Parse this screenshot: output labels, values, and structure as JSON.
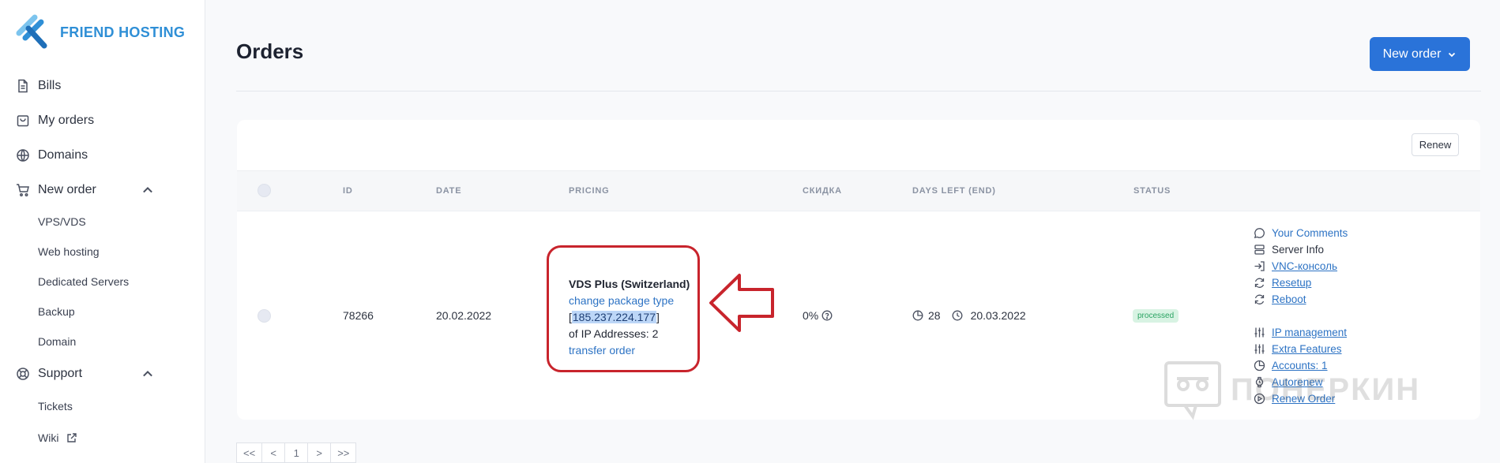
{
  "brand": {
    "name": "FRIEND HOSTING",
    "colors": {
      "accent": "#2a73d9",
      "annotation": "#c8242c",
      "status_ok": "#2aa362"
    }
  },
  "sidebar": {
    "items": [
      {
        "label": "Bills",
        "icon": "document-icon"
      },
      {
        "label": "My orders",
        "icon": "bag-icon"
      },
      {
        "label": "Domains",
        "icon": "globe-icon"
      },
      {
        "label": "New order",
        "icon": "cart-icon",
        "expanded": true,
        "children": [
          "VPS/VDS",
          "Web hosting",
          "Dedicated Servers",
          "Backup",
          "Domain"
        ]
      },
      {
        "label": "Support",
        "icon": "lifebuoy-icon",
        "expanded": true,
        "children": [
          "Tickets",
          "Wiki"
        ]
      }
    ]
  },
  "header": {
    "title": "Orders",
    "new_order_label": "New order"
  },
  "table": {
    "renew_label": "Renew",
    "columns": [
      "ID",
      "DATE",
      "PRICING",
      "СКИДКА",
      "DAYS LEFT (END)",
      "STATUS"
    ],
    "rows": [
      {
        "id": "78266",
        "date": "20.02.2022",
        "pricing": {
          "package": "VDS Plus (Switzerland)",
          "change_link": "change package type",
          "ip_open": "[",
          "ip": "185.237.224.177",
          "ip_close": "]",
          "ip_count": "of IP Addresses: 2",
          "transfer_link": "transfer order"
        },
        "discount": "0%",
        "days_left": "28",
        "end_date": "20.03.2022",
        "status": "processed",
        "actions": [
          "Your Comments",
          "Server Info",
          "VNC-консоль",
          "Resetup",
          "Reboot",
          "IP management",
          "Extra Features",
          "Accounts: 1",
          "Autorenew",
          "Renew Order"
        ]
      }
    ]
  },
  "pager": [
    "<<",
    "<",
    "1",
    ">",
    ">>"
  ],
  "watermark": "ПОНЕРКИН"
}
